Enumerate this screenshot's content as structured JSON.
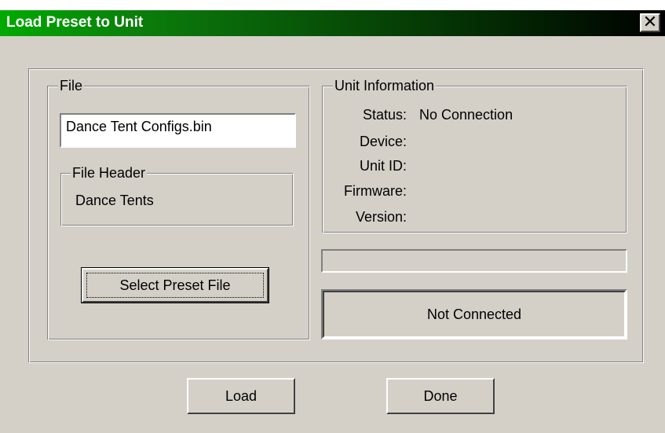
{
  "window": {
    "title": "Load Preset to Unit",
    "close_glyph": "✕"
  },
  "file_group": {
    "label": "File",
    "filename_value": "Dance Tent Configs.bin",
    "header_group_label": "File Header",
    "header_value": "Dance Tents",
    "select_button_label": "Select Preset File"
  },
  "unit_info": {
    "label": "Unit Information",
    "fields": [
      {
        "label": "Status:",
        "value": "No Connection"
      },
      {
        "label": "Device:",
        "value": ""
      },
      {
        "label": "Unit ID:",
        "value": ""
      },
      {
        "label": "Firmware:",
        "value": ""
      },
      {
        "label": "Version:",
        "value": ""
      }
    ],
    "progress": 0,
    "connection_status": "Not Connected"
  },
  "buttons": {
    "load_label": "Load",
    "done_label": "Done"
  }
}
